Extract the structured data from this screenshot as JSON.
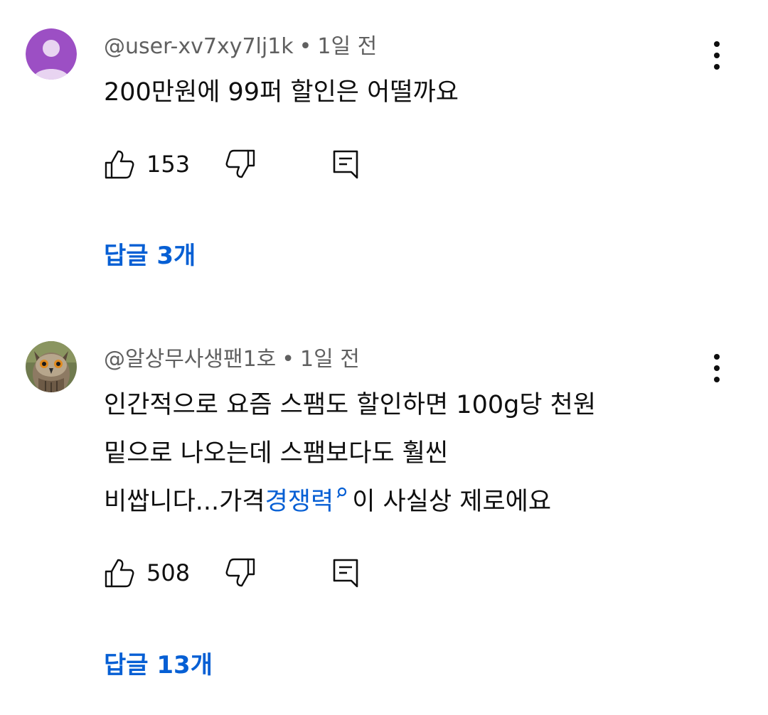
{
  "comments": [
    {
      "author": "@user-xv7xy7lj1k",
      "separator": "•",
      "time": "1일 전",
      "lines": [
        "200만원에 99퍼 할인은 어떨까요"
      ],
      "likes": "153",
      "replies_label": "답글 3개",
      "avatar_icon": "default-user-avatar",
      "avatar_color": "#9c4fc4"
    },
    {
      "author": "@알상무사생팬1호",
      "separator": "•",
      "time": "1일 전",
      "line1": "인간적으로 요즘 스팸도 할인하면 100g당 천원",
      "line2": "밑으로 나오는데 스팸보다도 훨씬",
      "line3_before": "비쌉니다...가격",
      "line3_link": "경쟁력",
      "line3_after": "이 사실상 제로에요",
      "likes": "508",
      "replies_label": "답글 13개",
      "avatar_icon": "owl-avatar"
    }
  ],
  "icons": {
    "like": "thumbs-up-icon",
    "dislike": "thumbs-down-icon",
    "reply": "reply-icon",
    "more": "more-vert-icon",
    "search": "search-icon"
  },
  "colors": {
    "link": "#065fd4",
    "meta": "#606060",
    "text": "#0f0f0f"
  }
}
